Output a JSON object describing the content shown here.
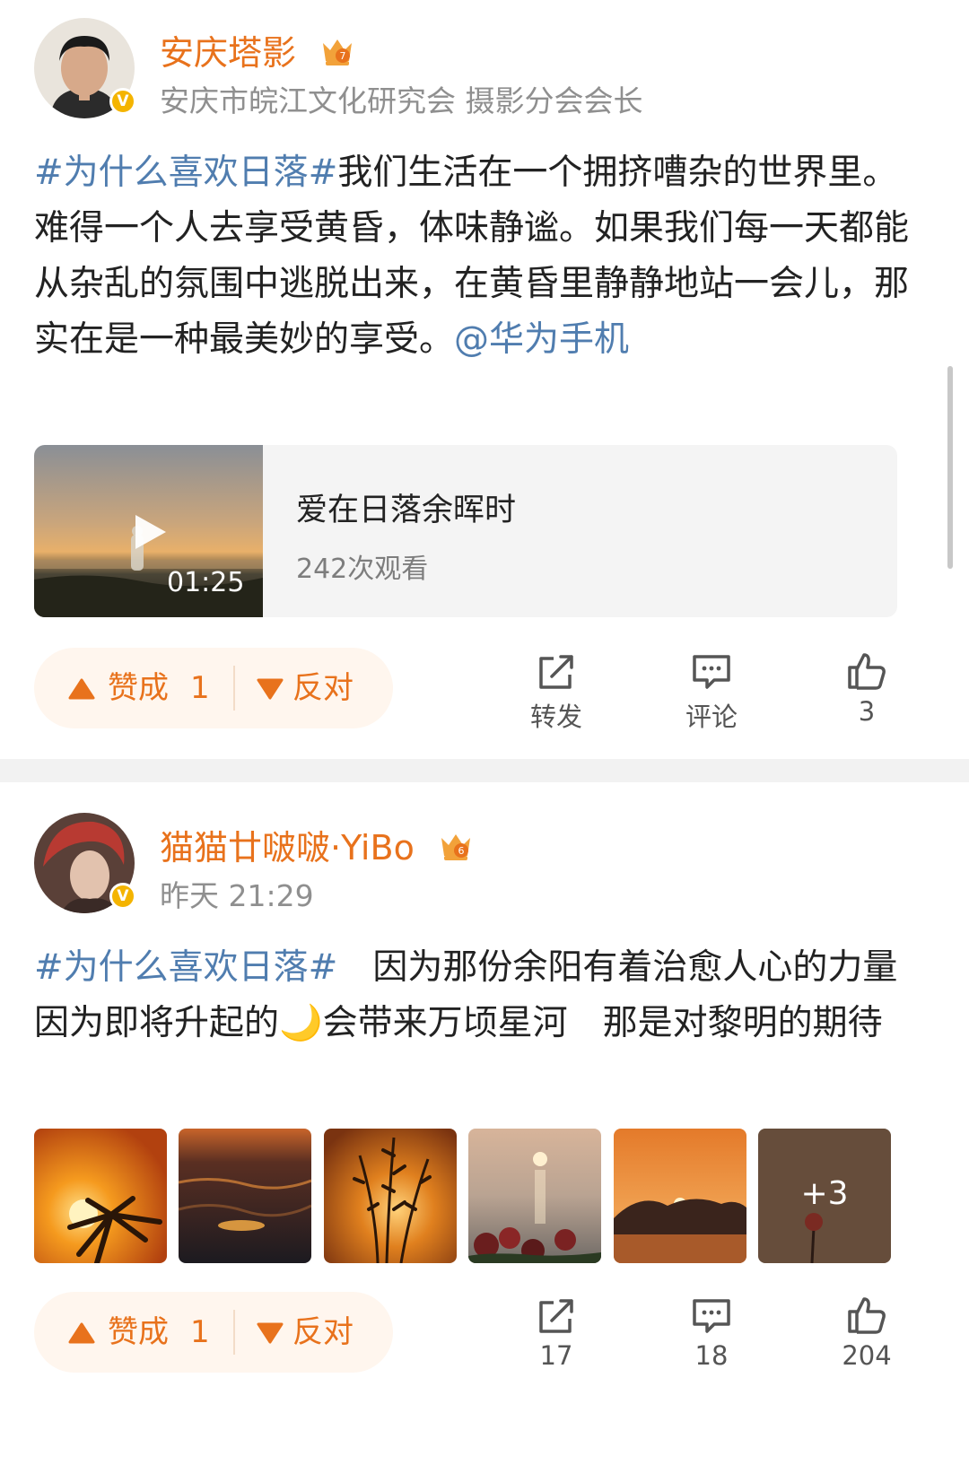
{
  "post1": {
    "author": "安庆塔影",
    "vip_level": "7",
    "verify_badge": "V",
    "subtitle": "安庆市皖江文化研究会 摄影分会会长",
    "content": {
      "hashtag": "#为什么喜欢日落#",
      "text": "我们生活在一个拥挤嘈杂的世界里。难得一个人去享受黄昏，体味静谧。如果我们每一天都能从杂乱的氛围中逃脱出来，在黄昏里静静地站一会儿，那实在是一种最美妙的享受。",
      "mention": "@华为手机"
    },
    "video": {
      "duration": "01:25",
      "title": "爱在日落余晖时",
      "views": "242次观看"
    },
    "votes": {
      "up_label": "赞成",
      "up_count": "1",
      "down_label": "反对"
    },
    "actions": {
      "repost": "转发",
      "comment": "评论",
      "like": "3"
    }
  },
  "post2": {
    "author": "猫猫廿啵啵·YiBo",
    "vip_level": "6",
    "verify_badge": "V",
    "time": "昨天 21:29",
    "content": {
      "hashtag": "#为什么喜欢日落#",
      "text_a": "　因为那份余阳有着治愈人心的力量　因为即将升起的",
      "emoji": "🌙",
      "text_b": "会带来万顷星河　那是对黎明的期待"
    },
    "photos_more": "+3",
    "votes": {
      "up_label": "赞成",
      "up_count": "1",
      "down_label": "反对"
    },
    "actions": {
      "repost": "17",
      "comment": "18",
      "like": "204"
    }
  },
  "colors": {
    "username": "#e8721c",
    "link": "#507daf",
    "vote": "#e8721c",
    "vote_bg": "#fff6ee",
    "separator": "#f2f2f2",
    "verified": "#f4b400"
  },
  "icons": [
    "crown-vip-icon",
    "verified-icon",
    "play-icon",
    "triangle-up-icon",
    "triangle-down-icon",
    "repost-icon",
    "comment-icon",
    "thumbs-up-icon"
  ]
}
